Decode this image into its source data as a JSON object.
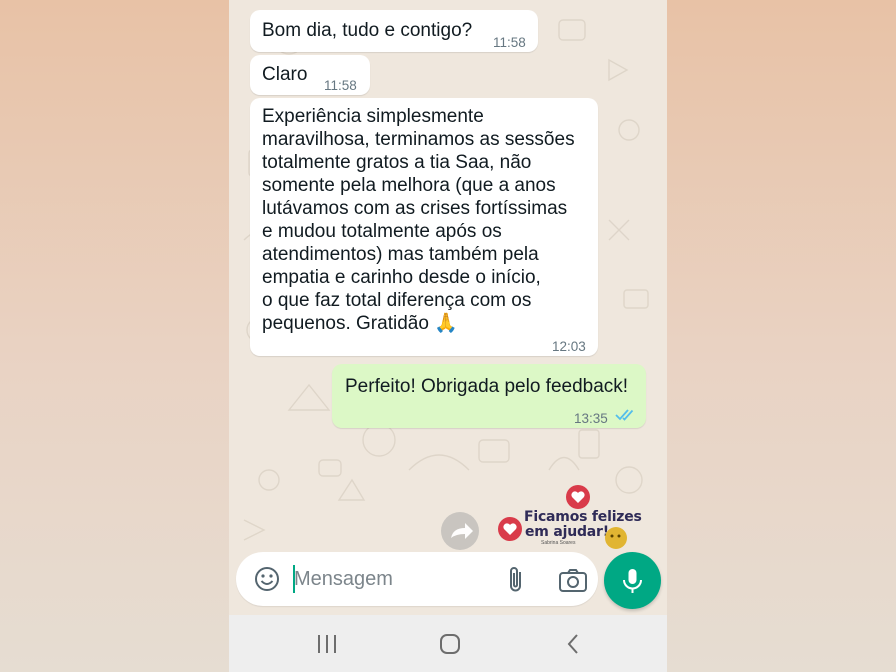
{
  "chat": {
    "messages": [
      {
        "direction": "incoming",
        "text": "Bom dia, tudo e contigo?",
        "time": "11:58"
      },
      {
        "direction": "incoming",
        "text": "Claro",
        "time": "11:58"
      },
      {
        "direction": "incoming",
        "text": "Experiência simplesmente\nmaravilhosa, terminamos as sessões\ntotalmente gratos a tia Saa, não\nsomente pela melhora (que a anos\nlutávamos com as crises fortíssimas\ne mudou totalmente após os\natendimentos) mas também pela\nempatia e carinho desde o início,\no que faz total diferença com os\npequenos. Gratidão 🙏",
        "time": "12:03"
      },
      {
        "direction": "outgoing",
        "text": "Perfeito! Obrigada pelo feedback!",
        "time": "13:35",
        "status": "read-double-check"
      }
    ],
    "sticker": {
      "line1": "Ficamos felizes",
      "line2": "em ajudar!",
      "small_text": "Sabrina Soares"
    }
  },
  "composer": {
    "placeholder": "Mensagem",
    "icons": [
      "emoji-icon",
      "attach-icon",
      "camera-icon",
      "mic-icon"
    ]
  },
  "colors": {
    "accent": "#00a884",
    "outgoing_bubble": "#dcf8c6",
    "incoming_bubble": "#ffffff",
    "read_ticks": "#53bdeb",
    "sticker_heart": "#d93b4a"
  },
  "navigation": {
    "icons": [
      "recent-apps-icon",
      "home-icon",
      "back-icon"
    ]
  }
}
